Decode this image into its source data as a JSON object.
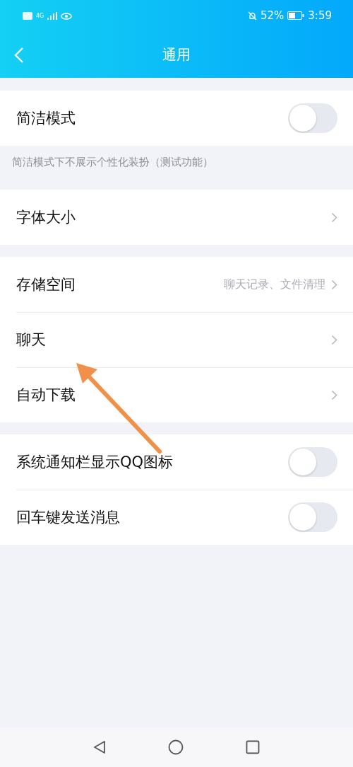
{
  "status_bar": {
    "network": "4G",
    "battery_percent": "52%",
    "time": "3:59"
  },
  "header": {
    "title": "通用"
  },
  "sections": [
    {
      "rows": [
        {
          "kind": "toggle",
          "label": "简洁模式",
          "on": false
        }
      ],
      "note": "简洁模式下不展示个性化装扮（测试功能）"
    },
    {
      "rows": [
        {
          "kind": "link",
          "label": "字体大小"
        }
      ]
    },
    {
      "rows": [
        {
          "kind": "link",
          "label": "存储空间",
          "detail": "聊天记录、文件清理"
        },
        {
          "kind": "link",
          "label": "聊天"
        },
        {
          "kind": "link",
          "label": "自动下载"
        }
      ]
    },
    {
      "rows": [
        {
          "kind": "toggle",
          "label": "系统通知栏显示QQ图标",
          "on": false
        },
        {
          "kind": "toggle",
          "label": "回车键发送消息",
          "on": false
        }
      ]
    }
  ]
}
